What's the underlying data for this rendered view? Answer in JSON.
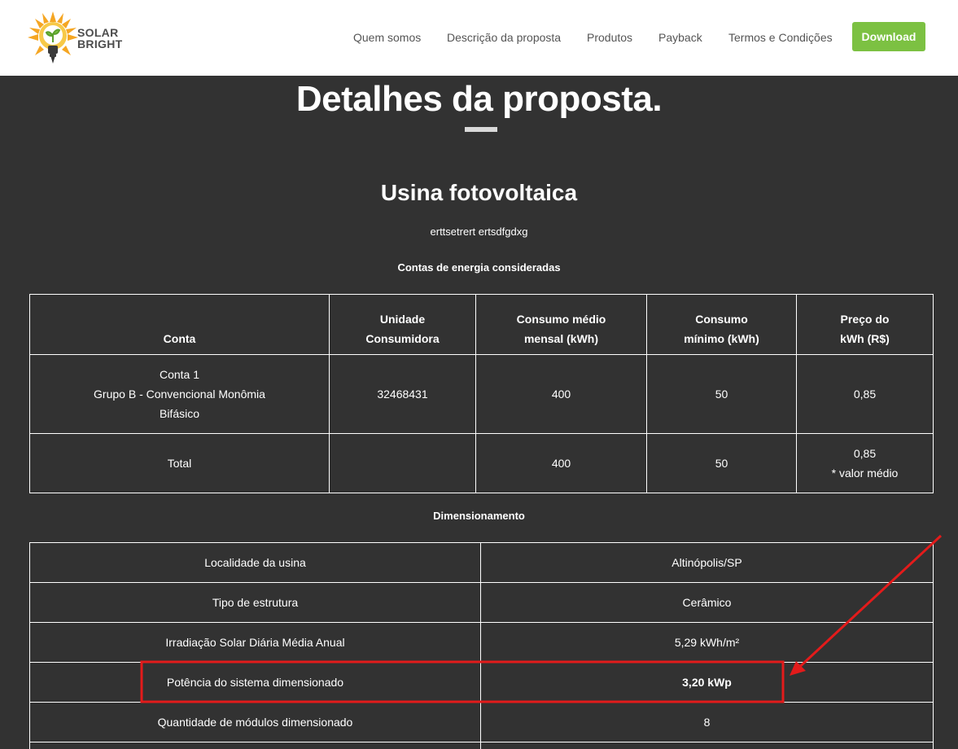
{
  "brand": {
    "line1": "SOLAR",
    "line2": "BRIGHT"
  },
  "nav": {
    "items": [
      "Quem somos",
      "Descrição da proposta",
      "Produtos",
      "Payback",
      "Termos e Condições"
    ],
    "download_label": "Download"
  },
  "page": {
    "title": "Detalhes da proposta.",
    "section_title": "Usina fotovoltaica",
    "subtitle": "erttsetrert ertsdfgdxg"
  },
  "contas": {
    "heading": "Contas de energia consideradas",
    "headers": {
      "conta": "Conta",
      "unidade_1": "Unidade",
      "unidade_2": "Consumidora",
      "consumo_1": "Consumo médio",
      "consumo_2": "mensal (kWh)",
      "minimo_1": "Consumo",
      "minimo_2": "mínimo (kWh)",
      "preco_1": "Preço do",
      "preco_2": "kWh (R$)"
    },
    "row1": {
      "conta_1": "Conta 1",
      "conta_2": "Grupo B - Convencional Monômia",
      "conta_3": "Bifásico",
      "unidade": "32468431",
      "consumo": "400",
      "minimo": "50",
      "preco": "0,85"
    },
    "total": {
      "label": "Total",
      "unidade": "",
      "consumo": "400",
      "minimo": "50",
      "preco": "0,85",
      "preco_note": "* valor médio"
    }
  },
  "dimensionamento": {
    "heading": "Dimensionamento",
    "rows": [
      {
        "label": "Localidade da usina",
        "value": "Altinópolis/SP"
      },
      {
        "label": "Tipo de estrutura",
        "value": "Cerâmico"
      },
      {
        "label": "Irradiação Solar Diária Média Anual",
        "value": "5,29 kWh/m²"
      },
      {
        "label": "Potência do sistema dimensionado",
        "value": "3,20 kWp"
      },
      {
        "label": "Quantidade de módulos dimensionado",
        "value": "8"
      },
      {
        "label": "",
        "value": ""
      }
    ]
  },
  "colors": {
    "background": "#323232",
    "accent_green": "#7cc142",
    "annotation_red": "#e31b1b",
    "sun_orange": "#f5a623"
  },
  "icons": [
    "solar-bright-logo-icon",
    "annotation-arrow-icon"
  ]
}
